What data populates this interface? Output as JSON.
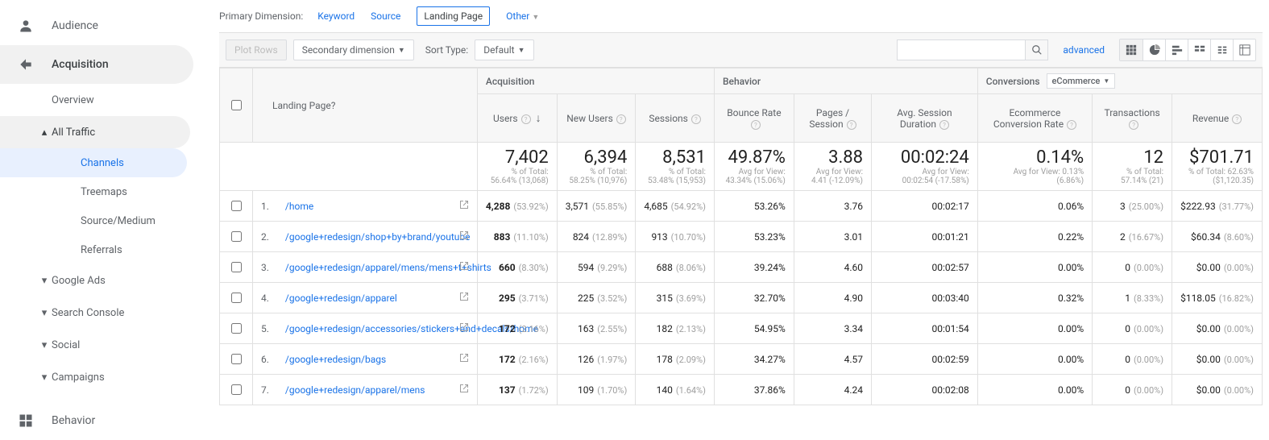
{
  "sidebar": {
    "audience": "Audience",
    "acquisition": "Acquisition",
    "overview": "Overview",
    "all_traffic": "All Traffic",
    "channels": "Channels",
    "treemaps": "Treemaps",
    "source_medium": "Source/Medium",
    "referrals": "Referrals",
    "google_ads": "Google Ads",
    "search_console": "Search Console",
    "social": "Social",
    "campaigns": "Campaigns",
    "behavior": "Behavior"
  },
  "dimrow": {
    "label": "Primary Dimension:",
    "keyword": "Keyword",
    "source": "Source",
    "landing": "Landing Page",
    "other": "Other"
  },
  "toolbar": {
    "plot_rows": "Plot Rows",
    "secondary": "Secondary dimension",
    "sort_label": "Sort Type:",
    "sort_default": "Default",
    "advanced": "advanced"
  },
  "headers": {
    "landing_page": "Landing Page",
    "acquisition": "Acquisition",
    "behavior": "Behavior",
    "conversions": "Conversions",
    "ecommerce": "eCommerce",
    "users": "Users",
    "new_users": "New Users",
    "sessions": "Sessions",
    "bounce": "Bounce Rate",
    "pps": "Pages / Session",
    "asd": "Avg. Session Duration",
    "ecr": "Ecommerce Conversion Rate",
    "trans": "Transactions",
    "rev": "Revenue"
  },
  "summary": {
    "users": {
      "big": "7,402",
      "sub1": "% of Total:",
      "sub2": "56.64% (13,068)"
    },
    "new_users": {
      "big": "6,394",
      "sub1": "% of Total:",
      "sub2": "58.25% (10,976)"
    },
    "sessions": {
      "big": "8,531",
      "sub1": "% of Total:",
      "sub2": "53.48% (15,953)"
    },
    "bounce": {
      "big": "49.87%",
      "sub1": "Avg for View:",
      "sub2": "43.34% (15.06%)"
    },
    "pps": {
      "big": "3.88",
      "sub1": "Avg for View:",
      "sub2": "4.41 (-12.09%)"
    },
    "asd": {
      "big": "00:02:24",
      "sub1": "Avg for View:",
      "sub2": "00:02:54 (-17.58%)"
    },
    "ecr": {
      "big": "0.14%",
      "sub1": "Avg for View: 0.13%",
      "sub2": "(6.86%)"
    },
    "trans": {
      "big": "12",
      "sub1": "% of Total:",
      "sub2": "57.14% (21)"
    },
    "rev": {
      "big": "$701.71",
      "sub1": "% of Total: 62.63%",
      "sub2": "($1,120.35)"
    }
  },
  "rows": [
    {
      "n": "1.",
      "page": "/home",
      "users": "4,288",
      "users_p": "(53.92%)",
      "nu": "3,571",
      "nu_p": "(55.85%)",
      "s": "4,685",
      "s_p": "(54.92%)",
      "b": "53.26%",
      "pps": "3.76",
      "asd": "00:02:17",
      "ecr": "0.06%",
      "t": "3",
      "t_p": "(25.00%)",
      "r": "$222.93",
      "r_p": "(31.77%)"
    },
    {
      "n": "2.",
      "page": "/google+redesign/shop+by+brand/youtube",
      "users": "883",
      "users_p": "(11.10%)",
      "nu": "824",
      "nu_p": "(12.89%)",
      "s": "913",
      "s_p": "(10.70%)",
      "b": "53.23%",
      "pps": "3.01",
      "asd": "00:01:21",
      "ecr": "0.22%",
      "t": "2",
      "t_p": "(16.67%)",
      "r": "$60.34",
      "r_p": "(8.60%)"
    },
    {
      "n": "3.",
      "page": "/google+redesign/apparel/mens/mens+t+shirts",
      "users": "660",
      "users_p": "(8.30%)",
      "nu": "594",
      "nu_p": "(9.29%)",
      "s": "688",
      "s_p": "(8.06%)",
      "b": "39.24%",
      "pps": "4.60",
      "asd": "00:02:57",
      "ecr": "0.00%",
      "t": "0",
      "t_p": "(0.00%)",
      "r": "$0.00",
      "r_p": "(0.00%)"
    },
    {
      "n": "4.",
      "page": "/google+redesign/apparel",
      "users": "295",
      "users_p": "(3.71%)",
      "nu": "225",
      "nu_p": "(3.52%)",
      "s": "315",
      "s_p": "(3.69%)",
      "b": "32.70%",
      "pps": "4.90",
      "asd": "00:03:40",
      "ecr": "0.32%",
      "t": "1",
      "t_p": "(8.33%)",
      "r": "$118.05",
      "r_p": "(16.82%)"
    },
    {
      "n": "5.",
      "page": "/google+redesign/accessories/stickers+and+decals/home",
      "users": "172",
      "users_p": "(2.16%)",
      "nu": "163",
      "nu_p": "(2.55%)",
      "s": "182",
      "s_p": "(2.13%)",
      "b": "54.95%",
      "pps": "3.34",
      "asd": "00:01:54",
      "ecr": "0.00%",
      "t": "0",
      "t_p": "(0.00%)",
      "r": "$0.00",
      "r_p": "(0.00%)"
    },
    {
      "n": "6.",
      "page": "/google+redesign/bags",
      "users": "172",
      "users_p": "(2.16%)",
      "nu": "126",
      "nu_p": "(1.97%)",
      "s": "178",
      "s_p": "(2.09%)",
      "b": "34.27%",
      "pps": "4.57",
      "asd": "00:02:59",
      "ecr": "0.00%",
      "t": "0",
      "t_p": "(0.00%)",
      "r": "$0.00",
      "r_p": "(0.00%)"
    },
    {
      "n": "7.",
      "page": "/google+redesign/apparel/mens",
      "users": "137",
      "users_p": "(1.72%)",
      "nu": "109",
      "nu_p": "(1.70%)",
      "s": "140",
      "s_p": "(1.64%)",
      "b": "37.86%",
      "pps": "4.24",
      "asd": "00:02:08",
      "ecr": "0.00%",
      "t": "0",
      "t_p": "(0.00%)",
      "r": "$0.00",
      "r_p": "(0.00%)"
    }
  ]
}
